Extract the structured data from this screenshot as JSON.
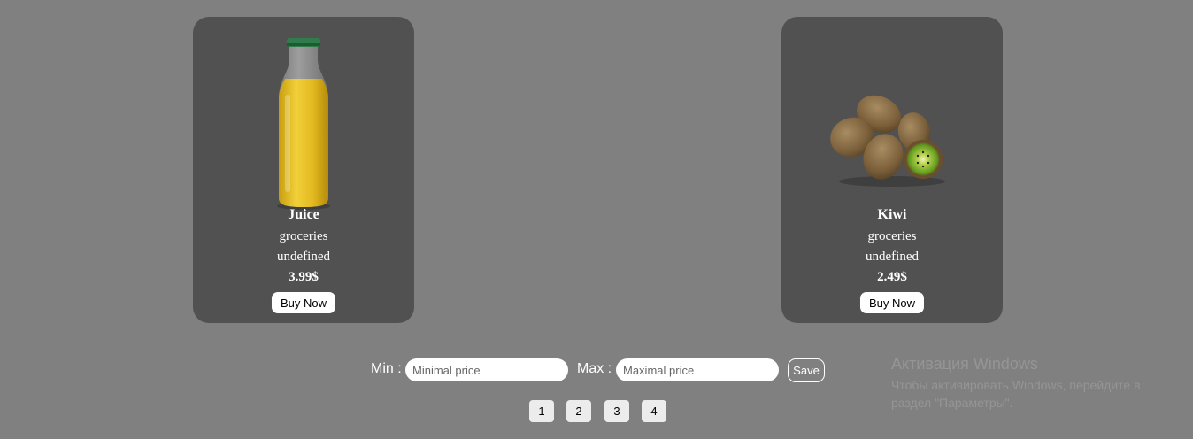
{
  "products": [
    {
      "name": "Juice",
      "category": "groceries",
      "description": "undefined",
      "price": "3.99$",
      "buy_label": "Buy Now",
      "image": "juice-bottle"
    },
    {
      "name": "Kiwi",
      "category": "groceries",
      "description": "undefined",
      "price": "2.49$",
      "buy_label": "Buy Now",
      "image": "kiwi-fruits"
    }
  ],
  "filter": {
    "min_label": "Min :",
    "min_placeholder": "Minimal price",
    "max_label": "Max :",
    "max_placeholder": "Maximal price",
    "save_label": "Save"
  },
  "pagination": {
    "pages": [
      "1",
      "2",
      "3",
      "4"
    ]
  },
  "watermark": {
    "title": "Активация Windows",
    "subtitle": "Чтобы активировать Windows, перейдите в раздел \"Параметры\"."
  },
  "colors": {
    "background": "#808080",
    "card": "#515151"
  }
}
